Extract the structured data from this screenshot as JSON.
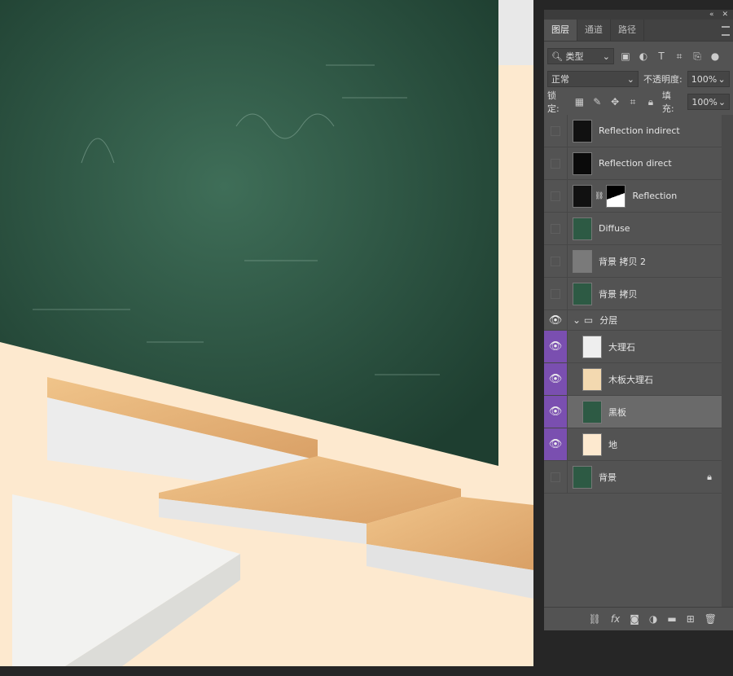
{
  "panel": {
    "collapse_icon": "double-chevron-left",
    "close_icon": "close",
    "tabs": [
      {
        "label": "图层",
        "active": true
      },
      {
        "label": "通道"
      },
      {
        "label": "路径"
      }
    ],
    "filter": {
      "label": "类型"
    },
    "blend_mode": "正常",
    "opacity_label": "不透明度:",
    "opacity": "100%",
    "lock_label": "锁定:",
    "fill_label": "填充:",
    "fill": "100%",
    "layers": [
      {
        "name": "Reflection indirect",
        "visible": false,
        "thumb": "#111"
      },
      {
        "name": "Reflection direct",
        "visible": false,
        "thumb": "#0a0a0a"
      },
      {
        "name": "Reflection",
        "visible": false,
        "thumb": "#111",
        "mask": true
      },
      {
        "name": "Diffuse",
        "visible": false,
        "thumb": "#2d5a44"
      },
      {
        "name": "背景 拷贝 2",
        "visible": false,
        "thumb": "#7a7a7a"
      },
      {
        "name": "背景 拷贝",
        "visible": false,
        "thumb": "#2d5a44"
      },
      {
        "name": "分层",
        "visible": true,
        "group": true
      },
      {
        "name": "大理石",
        "visible": true,
        "thumb": "#eeeeee",
        "child": true
      },
      {
        "name": "木板大理石",
        "visible": true,
        "thumb": "#f3d9b0",
        "child": true
      },
      {
        "name": "黑板",
        "visible": true,
        "thumb": "#2d5a44",
        "child": true,
        "selected": true
      },
      {
        "name": "地",
        "visible": true,
        "thumb": "#fde9cf",
        "child": true
      },
      {
        "name": "背景",
        "visible": false,
        "thumb": "#2d5a44",
        "locked": true
      }
    ],
    "bottom_icons": [
      "link",
      "fx",
      "mask",
      "adjustment",
      "folder",
      "new-layer",
      "trash"
    ],
    "accent": "#7a4fb0"
  }
}
